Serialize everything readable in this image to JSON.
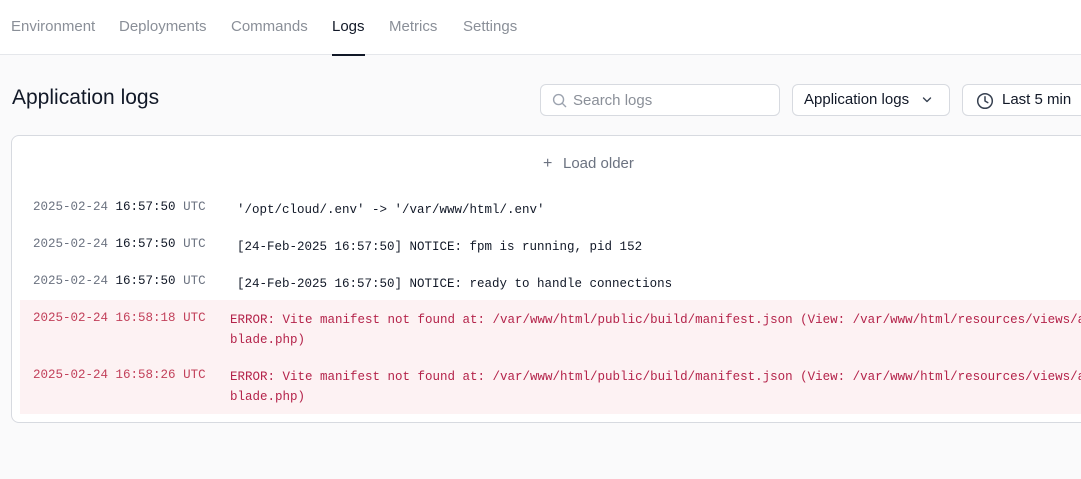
{
  "tabs": [
    {
      "label": "Environment",
      "active": false
    },
    {
      "label": "Deployments",
      "active": false
    },
    {
      "label": "Commands",
      "active": false
    },
    {
      "label": "Logs",
      "active": true
    },
    {
      "label": "Metrics",
      "active": false
    },
    {
      "label": "Settings",
      "active": false
    }
  ],
  "page": {
    "title": "Application logs"
  },
  "search": {
    "placeholder": "Search logs",
    "value": ""
  },
  "log_type_select": {
    "value": "Application logs"
  },
  "time_range": {
    "value": "Last 5 min"
  },
  "load_older": {
    "label": "Load older"
  },
  "logs": [
    {
      "date": "2025-02-24",
      "time": "16:57:50",
      "tz": "UTC",
      "level": "info",
      "message": "'/opt/cloud/.env' -> '/var/www/html/.env'"
    },
    {
      "date": "2025-02-24",
      "time": "16:57:50",
      "tz": "UTC",
      "level": "info",
      "message": "[24-Feb-2025 16:57:50] NOTICE: fpm is running, pid 152"
    },
    {
      "date": "2025-02-24",
      "time": "16:57:50",
      "tz": "UTC",
      "level": "info",
      "message": "[24-Feb-2025 16:57:50] NOTICE: ready to handle connections"
    },
    {
      "date": "2025-02-24",
      "time": "16:58:18",
      "tz": "UTC",
      "level": "error",
      "message": "ERROR: Vite manifest not found at: /var/www/html/public/build/manifest.json (View: /var/www/html/resources/views/app.blade.php)"
    },
    {
      "date": "2025-02-24",
      "time": "16:58:26",
      "tz": "UTC",
      "level": "error",
      "message": "ERROR: Vite manifest not found at: /var/www/html/public/build/manifest.json (View: /var/www/html/resources/views/app.blade.php)"
    }
  ],
  "colors": {
    "accent": "#111827",
    "muted": "#8a8f98",
    "error_text": "#b4234a",
    "error_bg": "#fdf2f3"
  }
}
